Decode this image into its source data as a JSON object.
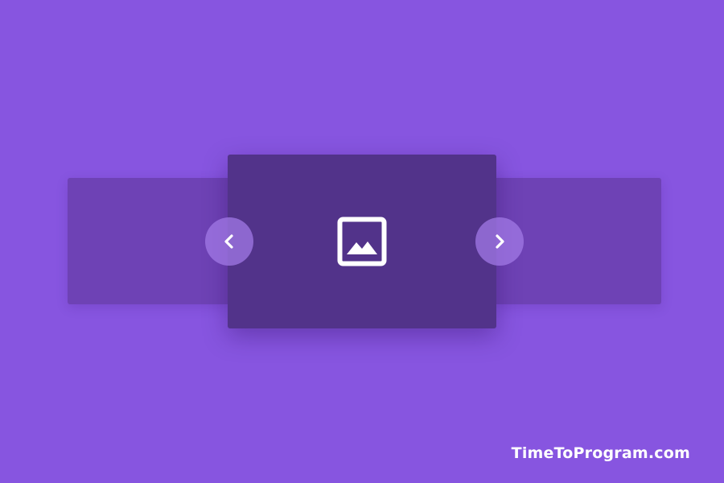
{
  "colors": {
    "background": "#8755e0",
    "side_slide": "#6e42b5",
    "main_slide": "#52338a",
    "nav_button": "#a27ae6",
    "icon": "#ffffff"
  },
  "carousel": {
    "main_slide_icon": "image-icon",
    "prev_button_icon": "chevron-left-icon",
    "next_button_icon": "chevron-right-icon"
  },
  "brand": {
    "text": "TimeToProgram.com"
  }
}
